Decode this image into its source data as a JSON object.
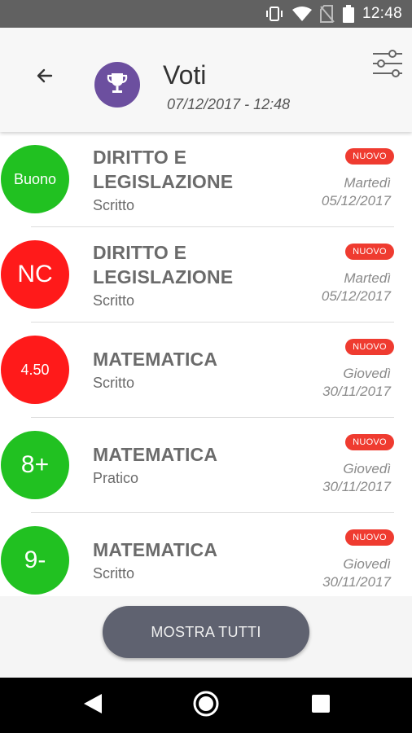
{
  "status_bar": {
    "time": "12:48"
  },
  "header": {
    "title": "Voti",
    "subtitle": "07/12/2017 - 12:48",
    "accent": "#6c4f9f"
  },
  "grades": [
    {
      "grade": "Buono",
      "grade_color": "#21c121",
      "subject_line1": "DIRITTO E",
      "subject_line2": "LEGISLAZIONE",
      "type": "Scritto",
      "badge": "NUOVO",
      "day": "Martedì",
      "date": "05/12/2017"
    },
    {
      "grade": "NC",
      "grade_color": "#ff1a1a",
      "subject_line1": "DIRITTO E",
      "subject_line2": "LEGISLAZIONE",
      "type": "Scritto",
      "badge": "NUOVO",
      "day": "Martedì",
      "date": "05/12/2017"
    },
    {
      "grade": "4.50",
      "grade_color": "#ff1a1a",
      "subject_line1": "MATEMATICA",
      "subject_line2": "",
      "type": "Scritto",
      "badge": "NUOVO",
      "day": "Giovedì",
      "date": "30/11/2017"
    },
    {
      "grade": "8+",
      "grade_color": "#21c121",
      "subject_line1": "MATEMATICA",
      "subject_line2": "",
      "type": "Pratico",
      "badge": "NUOVO",
      "day": "Giovedì",
      "date": "30/11/2017"
    },
    {
      "grade": "9-",
      "grade_color": "#21c121",
      "subject_line1": "MATEMATICA",
      "subject_line2": "",
      "type": "Scritto",
      "badge": "NUOVO",
      "day": "Giovedì",
      "date": "30/11/2017"
    }
  ],
  "footer": {
    "button_label": "MOSTRA TUTTI"
  },
  "icons": {
    "back": "arrow-left-icon",
    "trophy": "trophy-icon",
    "filter": "sliders-icon",
    "nav_back": "triangle-back-icon",
    "nav_home": "circle-home-icon",
    "nav_recents": "square-recents-icon"
  }
}
